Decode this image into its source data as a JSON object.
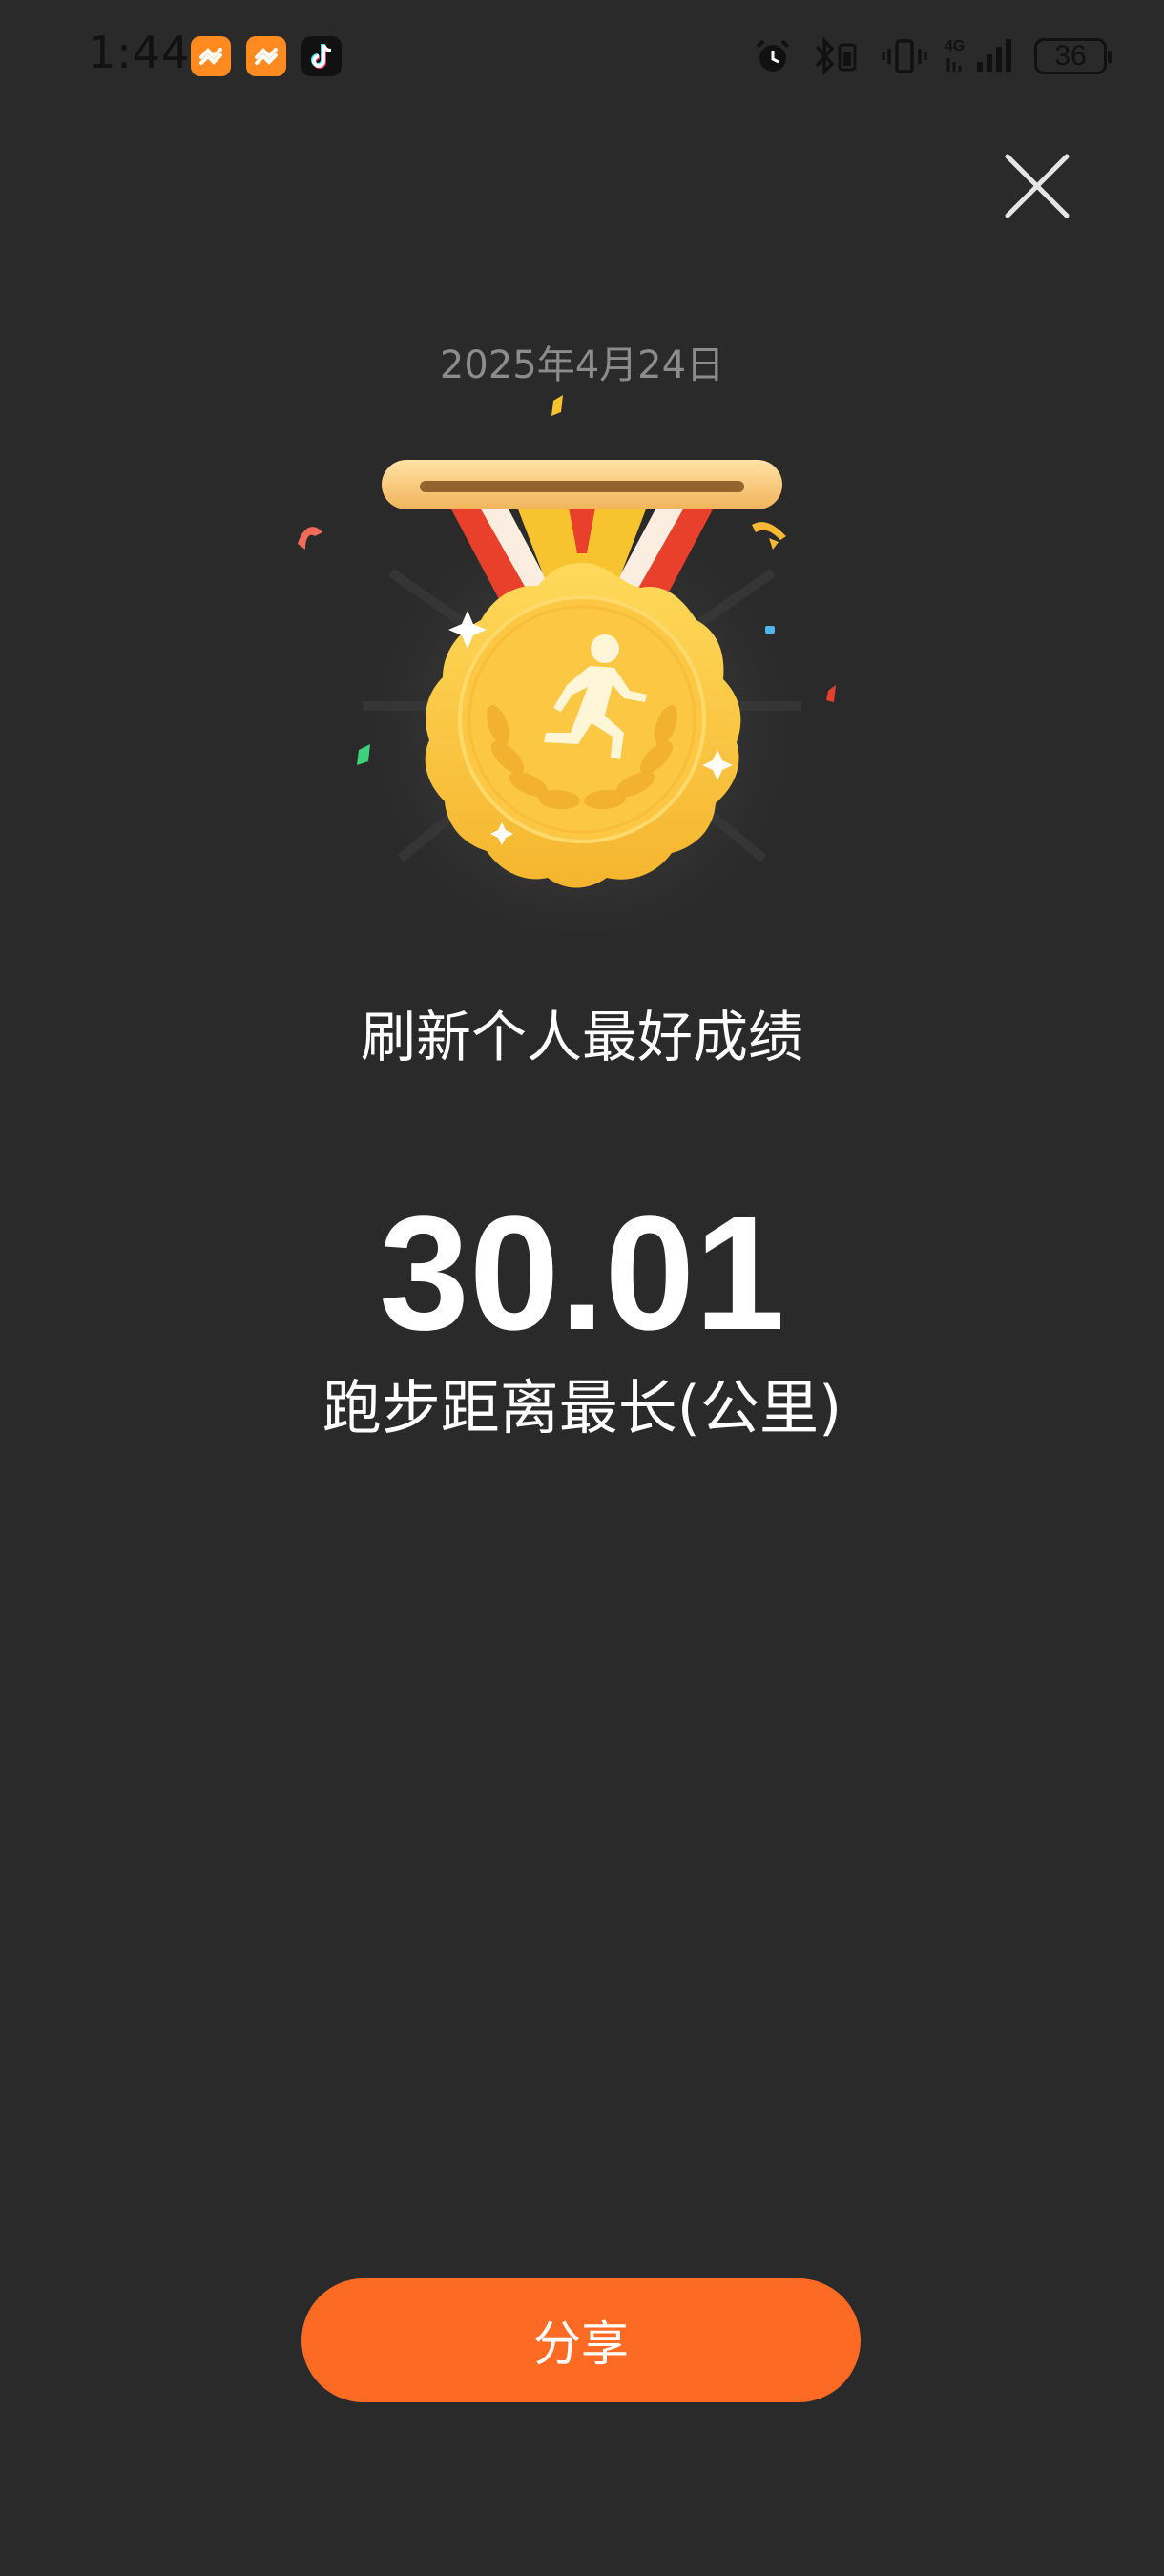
{
  "status_bar": {
    "time": "1:44",
    "battery": "36",
    "network": "4G",
    "app_icons": [
      "orange-app-icon",
      "orange-app-icon",
      "tiktok-icon"
    ]
  },
  "header": {
    "close_icon": "close-icon"
  },
  "achievement": {
    "date": "2025年4月24日",
    "medal_icon": "running-medal-icon",
    "title": "刷新个人最好成绩",
    "value": "30.01",
    "label": "跑步距离最长(公里)"
  },
  "actions": {
    "share_label": "分享"
  },
  "colors": {
    "background": "#2a2a2a",
    "accent": "#fc6a24",
    "medal_gold": "#fcc843"
  }
}
